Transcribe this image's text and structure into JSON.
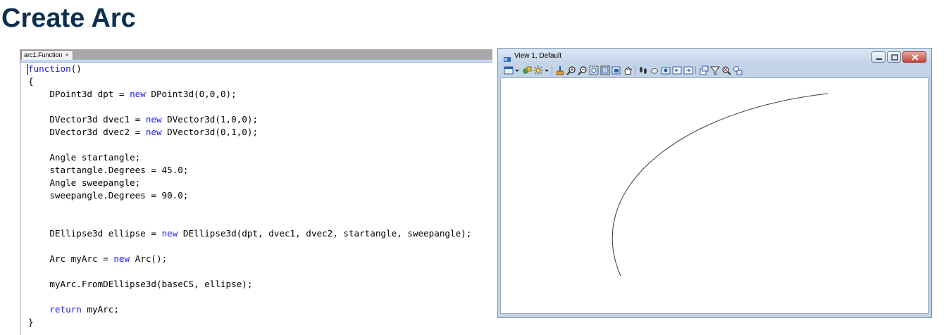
{
  "page": {
    "title": "Create Arc"
  },
  "editor": {
    "tab_label": "arc1.Function",
    "tab_close": "×",
    "lines": [
      [
        "",
        "function",
        "()"
      ],
      [
        "{",
        "",
        ""
      ],
      [
        "    DPoint3d dpt = ",
        "new",
        " DPoint3d(0,0,0);"
      ],
      [
        "    DVector3d dvec1 = ",
        "new",
        " DVector3d(1,0,0);"
      ],
      [
        "    DVector3d dvec2 = ",
        "new",
        " DVector3d(0,1,0);"
      ],
      [
        "    Angle startangle;",
        "",
        ""
      ],
      [
        "    startangle.Degrees = 45.0;",
        "",
        ""
      ],
      [
        "    Angle sweepangle;",
        "",
        ""
      ],
      [
        "    sweepangle.Degrees = 90.0;",
        "",
        ""
      ],
      [
        "    DEllipse3d ellipse = ",
        "new",
        " DEllipse3d(dpt, dvec1, dvec2, startangle, sweepangle);"
      ],
      [
        "    Arc myArc = ",
        "new",
        " Arc();"
      ],
      [
        "    myArc.FromDEllipse3d(baseCS, ellipse);",
        "",
        ""
      ],
      [
        "    ",
        "return",
        " myArc;"
      ],
      [
        "}",
        "",
        ""
      ]
    ]
  },
  "view": {
    "title": "View 1, Default",
    "toolbar_icons": [
      "view-display-icon",
      "dropdown-arrow-icon",
      "view-attributes-icon",
      "lights-icon",
      "dropdown-arrow-icon",
      "render-icon",
      "zoom-in-icon",
      "zoom-out-icon",
      "window-area-icon",
      "fit-view-icon",
      "rotate-view-icon",
      "pan-view-icon",
      "walk-icon",
      "view-previous-icon",
      "view-next-icon",
      "copy-view-icon",
      "clip-volume-icon",
      "clip-mask-icon",
      "view-toggles-icon",
      "camera-icon",
      "settings-icon"
    ],
    "colors": {
      "arc_stroke": "#3a3a3a",
      "title_color": "#0d2f4e",
      "keyword_color": "#1a1aff"
    }
  }
}
